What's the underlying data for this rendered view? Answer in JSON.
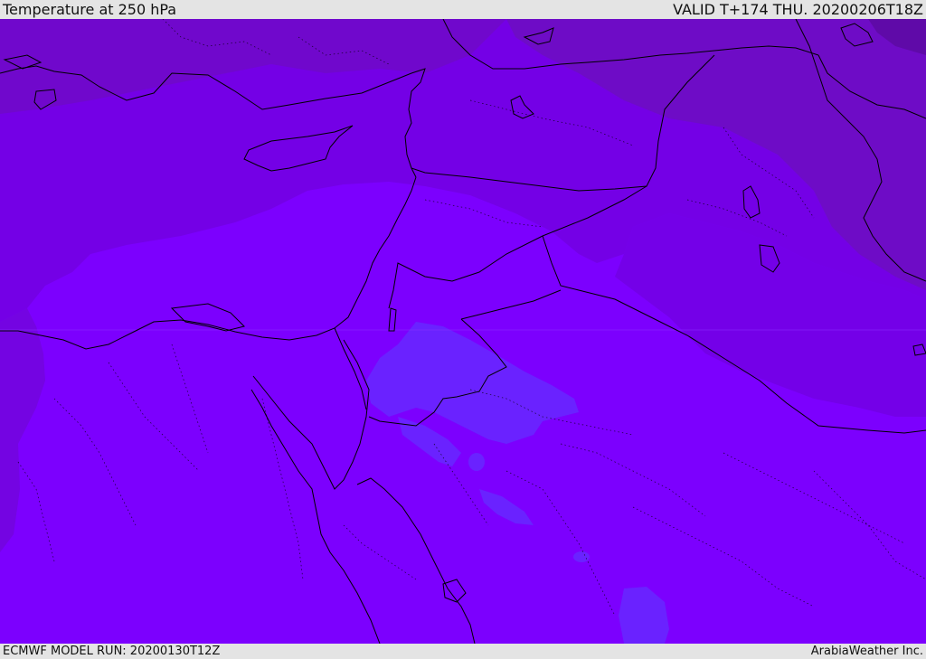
{
  "header": {
    "title": "Temperature at 250 hPa",
    "valid_time": "VALID T+174 THU. 20200206T18Z"
  },
  "footer": {
    "model_run": "ECMWF MODEL RUN: 20200130T12Z",
    "credit": "ArabiaWeather Inc."
  },
  "map": {
    "field": "temperature",
    "level": "250 hPa",
    "colors": {
      "warm_core": "#7f00ff",
      "mid": "#7800e8",
      "cool": "#7208d0",
      "coldest": "#6a0ab8",
      "pocket": "#6a22ff",
      "boundary": "#000000"
    }
  }
}
